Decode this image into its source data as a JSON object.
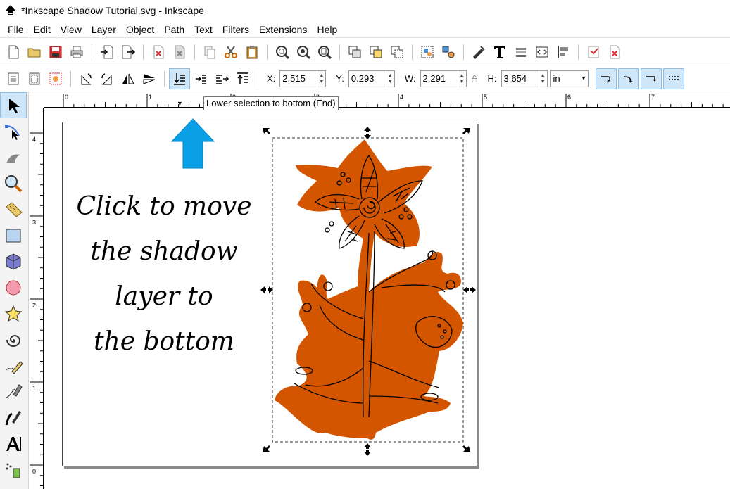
{
  "window": {
    "title": "*Inkscape Shadow Tutorial.svg - Inkscape"
  },
  "menu": [
    {
      "label": "File",
      "mn": "F",
      "rest": "ile"
    },
    {
      "label": "Edit",
      "mn": "E",
      "rest": "dit"
    },
    {
      "label": "View",
      "mn": "V",
      "rest": "iew"
    },
    {
      "label": "Layer",
      "mn": "L",
      "rest": "ayer"
    },
    {
      "label": "Object",
      "mn": "O",
      "rest": "bject"
    },
    {
      "label": "Path",
      "mn": "P",
      "rest": "ath"
    },
    {
      "label": "Text",
      "mn": "T",
      "rest": "ext"
    },
    {
      "label": "Filters",
      "pre": "F",
      "mn": "i",
      "rest": "lters"
    },
    {
      "label": "Extensions",
      "pre": "Exte",
      "mn": "n",
      "rest": "sions"
    },
    {
      "label": "Help",
      "mn": "H",
      "rest": "elp"
    }
  ],
  "controls": {
    "x_label": "X:",
    "x_value": "2.515",
    "y_label": "Y:",
    "y_value": "0.293",
    "w_label": "W:",
    "w_value": "2.291",
    "h_label": "H:",
    "h_value": "3.654",
    "unit": "in"
  },
  "tooltip": {
    "text": "Lower selection to bottom (End)"
  },
  "ruler": {
    "h_labels": [
      "0",
      "1",
      "2",
      "3",
      "4",
      "5",
      "6",
      "7"
    ],
    "v_labels": [
      "4",
      "3",
      "2",
      "1",
      "0"
    ]
  },
  "annotation": {
    "lines": [
      "Click to move",
      "the shadow",
      "layer to",
      "the bottom"
    ]
  },
  "colors": {
    "accent": "#0aa0e6",
    "flower_fill": "#d45500",
    "flower_outline": "#000000",
    "selection_highlight": "#cfe6f9"
  },
  "icons": {
    "command_bar": [
      "new-document-icon",
      "open-icon",
      "save-icon",
      "print-icon",
      "import-icon",
      "export-icon",
      "undo-icon",
      "redo-icon",
      "copy-icon",
      "cut-icon",
      "paste-icon",
      "zoom-selection-icon",
      "zoom-drawing-icon",
      "zoom-page-icon",
      "duplicate-icon",
      "clone-icon",
      "unlink-clone-icon",
      "group-icon",
      "ungroup-icon",
      "fill-stroke-icon",
      "text-font-icon",
      "layers-icon",
      "xml-editor-icon",
      "align-distribute-icon",
      "preferences-icon",
      "document-properties-icon"
    ],
    "tools": [
      "selector-tool-icon",
      "node-tool-icon",
      "tweak-tool-icon",
      "zoom-tool-icon",
      "measure-tool-icon",
      "rectangle-tool-icon",
      "box-3d-tool-icon",
      "ellipse-tool-icon",
      "star-tool-icon",
      "spiral-tool-icon",
      "pencil-tool-icon",
      "pen-tool-icon",
      "calligraphy-tool-icon",
      "text-tool-icon",
      "spray-tool-icon"
    ]
  }
}
